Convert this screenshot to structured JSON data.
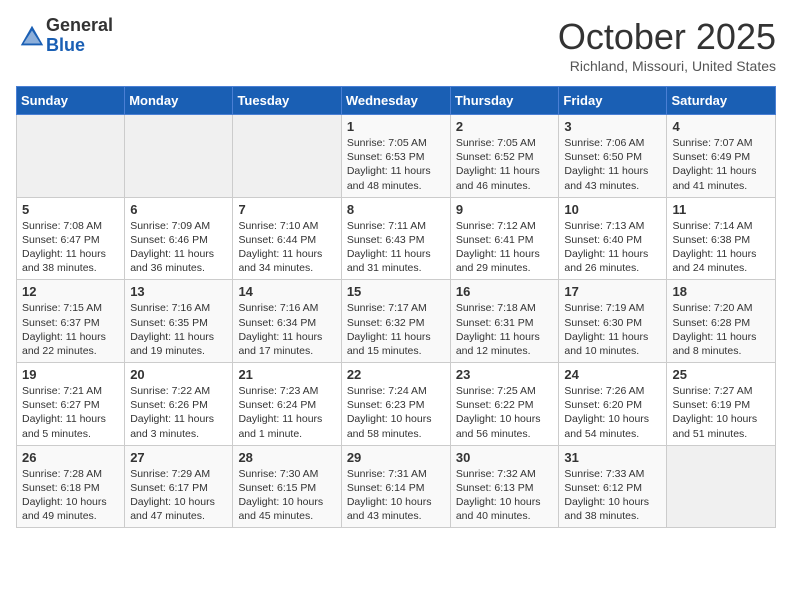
{
  "logo": {
    "general": "General",
    "blue": "Blue"
  },
  "header": {
    "month": "October 2025",
    "location": "Richland, Missouri, United States"
  },
  "weekdays": [
    "Sunday",
    "Monday",
    "Tuesday",
    "Wednesday",
    "Thursday",
    "Friday",
    "Saturday"
  ],
  "weeks": [
    [
      {
        "day": "",
        "info": ""
      },
      {
        "day": "",
        "info": ""
      },
      {
        "day": "",
        "info": ""
      },
      {
        "day": "1",
        "info": "Sunrise: 7:05 AM\nSunset: 6:53 PM\nDaylight: 11 hours\nand 48 minutes."
      },
      {
        "day": "2",
        "info": "Sunrise: 7:05 AM\nSunset: 6:52 PM\nDaylight: 11 hours\nand 46 minutes."
      },
      {
        "day": "3",
        "info": "Sunrise: 7:06 AM\nSunset: 6:50 PM\nDaylight: 11 hours\nand 43 minutes."
      },
      {
        "day": "4",
        "info": "Sunrise: 7:07 AM\nSunset: 6:49 PM\nDaylight: 11 hours\nand 41 minutes."
      }
    ],
    [
      {
        "day": "5",
        "info": "Sunrise: 7:08 AM\nSunset: 6:47 PM\nDaylight: 11 hours\nand 38 minutes."
      },
      {
        "day": "6",
        "info": "Sunrise: 7:09 AM\nSunset: 6:46 PM\nDaylight: 11 hours\nand 36 minutes."
      },
      {
        "day": "7",
        "info": "Sunrise: 7:10 AM\nSunset: 6:44 PM\nDaylight: 11 hours\nand 34 minutes."
      },
      {
        "day": "8",
        "info": "Sunrise: 7:11 AM\nSunset: 6:43 PM\nDaylight: 11 hours\nand 31 minutes."
      },
      {
        "day": "9",
        "info": "Sunrise: 7:12 AM\nSunset: 6:41 PM\nDaylight: 11 hours\nand 29 minutes."
      },
      {
        "day": "10",
        "info": "Sunrise: 7:13 AM\nSunset: 6:40 PM\nDaylight: 11 hours\nand 26 minutes."
      },
      {
        "day": "11",
        "info": "Sunrise: 7:14 AM\nSunset: 6:38 PM\nDaylight: 11 hours\nand 24 minutes."
      }
    ],
    [
      {
        "day": "12",
        "info": "Sunrise: 7:15 AM\nSunset: 6:37 PM\nDaylight: 11 hours\nand 22 minutes."
      },
      {
        "day": "13",
        "info": "Sunrise: 7:16 AM\nSunset: 6:35 PM\nDaylight: 11 hours\nand 19 minutes."
      },
      {
        "day": "14",
        "info": "Sunrise: 7:16 AM\nSunset: 6:34 PM\nDaylight: 11 hours\nand 17 minutes."
      },
      {
        "day": "15",
        "info": "Sunrise: 7:17 AM\nSunset: 6:32 PM\nDaylight: 11 hours\nand 15 minutes."
      },
      {
        "day": "16",
        "info": "Sunrise: 7:18 AM\nSunset: 6:31 PM\nDaylight: 11 hours\nand 12 minutes."
      },
      {
        "day": "17",
        "info": "Sunrise: 7:19 AM\nSunset: 6:30 PM\nDaylight: 11 hours\nand 10 minutes."
      },
      {
        "day": "18",
        "info": "Sunrise: 7:20 AM\nSunset: 6:28 PM\nDaylight: 11 hours\nand 8 minutes."
      }
    ],
    [
      {
        "day": "19",
        "info": "Sunrise: 7:21 AM\nSunset: 6:27 PM\nDaylight: 11 hours\nand 5 minutes."
      },
      {
        "day": "20",
        "info": "Sunrise: 7:22 AM\nSunset: 6:26 PM\nDaylight: 11 hours\nand 3 minutes."
      },
      {
        "day": "21",
        "info": "Sunrise: 7:23 AM\nSunset: 6:24 PM\nDaylight: 11 hours\nand 1 minute."
      },
      {
        "day": "22",
        "info": "Sunrise: 7:24 AM\nSunset: 6:23 PM\nDaylight: 10 hours\nand 58 minutes."
      },
      {
        "day": "23",
        "info": "Sunrise: 7:25 AM\nSunset: 6:22 PM\nDaylight: 10 hours\nand 56 minutes."
      },
      {
        "day": "24",
        "info": "Sunrise: 7:26 AM\nSunset: 6:20 PM\nDaylight: 10 hours\nand 54 minutes."
      },
      {
        "day": "25",
        "info": "Sunrise: 7:27 AM\nSunset: 6:19 PM\nDaylight: 10 hours\nand 51 minutes."
      }
    ],
    [
      {
        "day": "26",
        "info": "Sunrise: 7:28 AM\nSunset: 6:18 PM\nDaylight: 10 hours\nand 49 minutes."
      },
      {
        "day": "27",
        "info": "Sunrise: 7:29 AM\nSunset: 6:17 PM\nDaylight: 10 hours\nand 47 minutes."
      },
      {
        "day": "28",
        "info": "Sunrise: 7:30 AM\nSunset: 6:15 PM\nDaylight: 10 hours\nand 45 minutes."
      },
      {
        "day": "29",
        "info": "Sunrise: 7:31 AM\nSunset: 6:14 PM\nDaylight: 10 hours\nand 43 minutes."
      },
      {
        "day": "30",
        "info": "Sunrise: 7:32 AM\nSunset: 6:13 PM\nDaylight: 10 hours\nand 40 minutes."
      },
      {
        "day": "31",
        "info": "Sunrise: 7:33 AM\nSunset: 6:12 PM\nDaylight: 10 hours\nand 38 minutes."
      },
      {
        "day": "",
        "info": ""
      }
    ]
  ]
}
